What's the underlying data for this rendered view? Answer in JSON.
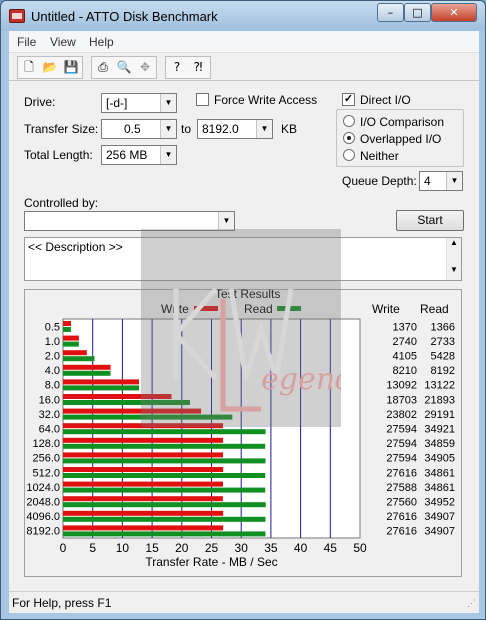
{
  "window": {
    "title": "Untitled - ATTO Disk Benchmark",
    "min": "–",
    "max": "□",
    "close": "✕"
  },
  "menu": [
    "File",
    "View",
    "Help"
  ],
  "toolbar": [
    "new-icon",
    "open-icon",
    "save-icon",
    "print-icon",
    "print-preview-icon",
    "move-icon",
    "help-icon",
    "context-help-icon"
  ],
  "settings": {
    "drive_label": "Drive:",
    "drive_value": "[-d-]",
    "transfer_label": "Transfer Size:",
    "transfer_from": "0.5",
    "to_label": "to",
    "transfer_to": "8192.0",
    "kb_label": "KB",
    "length_label": "Total Length:",
    "length_value": "256 MB",
    "force_write": "Force Write Access",
    "direct_io": "Direct I/O",
    "io_comparison": "I/O Comparison",
    "overlapped_io": "Overlapped I/O",
    "neither": "Neither",
    "queue_label": "Queue Depth:",
    "queue_value": "4",
    "controlled_label": "Controlled by:",
    "controlled_value": "",
    "start": "Start",
    "description": "<< Description >>"
  },
  "legend": {
    "title": "Test Results",
    "write": "Write",
    "read": "Read"
  },
  "columns": {
    "write": "Write",
    "read": "Read"
  },
  "status": "For Help, press F1",
  "colors": {
    "write": "#e01010",
    "read": "#109020",
    "grid": "#1a1aa0"
  },
  "chart_data": {
    "type": "bar",
    "title": "Test Results",
    "xlabel": "Transfer Rate - MB / Sec",
    "xlim": [
      0,
      50
    ],
    "xticks": [
      0,
      5,
      10,
      15,
      20,
      25,
      30,
      35,
      40,
      45,
      50
    ],
    "categories": [
      "0.5",
      "1.0",
      "2.0",
      "4.0",
      "8.0",
      "16.0",
      "32.0",
      "64.0",
      "128.0",
      "256.0",
      "512.0",
      "1024.0",
      "2048.0",
      "4096.0",
      "8192.0"
    ],
    "series": [
      {
        "name": "Write",
        "values": [
          1370,
          2740,
          4105,
          8210,
          13092,
          18703,
          23802,
          27594,
          27594,
          27594,
          27616,
          27588,
          27560,
          27616,
          27616
        ]
      },
      {
        "name": "Read",
        "values": [
          1366,
          2733,
          5428,
          8192,
          13122,
          21893,
          29191,
          34921,
          34859,
          34905,
          34861,
          34861,
          34952,
          34907,
          34907
        ]
      }
    ]
  },
  "watermark": {
    "text": "KW Legend"
  }
}
